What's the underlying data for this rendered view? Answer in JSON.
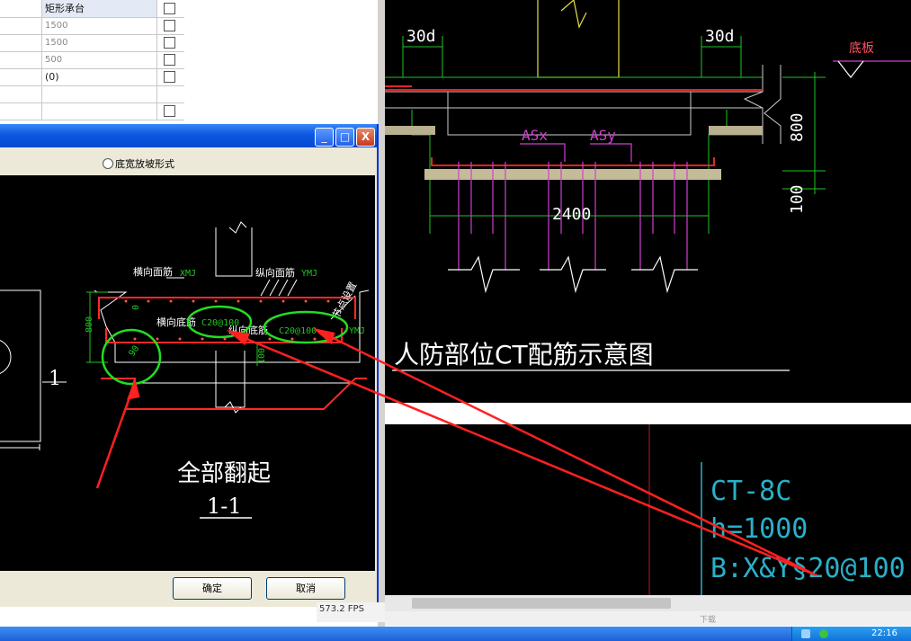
{
  "property_table": {
    "rows": [
      {
        "value": "矩形承台",
        "checked": false,
        "header": true
      },
      {
        "value": "1500",
        "checked": false
      },
      {
        "value": "1500",
        "checked": false
      },
      {
        "value": "500",
        "checked": false
      },
      {
        "value": "(0)",
        "checked": false
      },
      {
        "value": "",
        "checked": false
      },
      {
        "value": "",
        "checked": false
      }
    ]
  },
  "dialog": {
    "option_label": "底宽放坡形式",
    "ok_label": "确定",
    "cancel_label": "取消",
    "min_glyph": "_",
    "max_glyph": "□",
    "close_glyph": "X"
  },
  "drawing_left": {
    "section_mark": "1",
    "label_top_transverse": "横向面筋",
    "label_top_transverse_code": "XMJ",
    "label_top_longitudinal": "纵向面筋",
    "label_top_longitudinal_code": "YMJ",
    "label_node": "节点设置",
    "label_bottom_transverse": "横向底筋",
    "label_bottom_transverse_spec": "C20@100",
    "label_bottom_longitudinal": "纵向底筋",
    "label_bottom_longitudinal_spec": "C20@100",
    "label_bottom_longitudinal_code": "YMJ",
    "dim_800": "800",
    "dim_0": "0",
    "dim_90": "90",
    "dim_100": "100",
    "annotation": "全部翻起",
    "section_title": "1-1"
  },
  "drawing_right": {
    "dim_30d_left": "30d",
    "dim_30d_right": "30d",
    "label_floor": "底板",
    "label_asx": "ASx",
    "label_asy": "ASy",
    "dim_2400": "2400",
    "dim_800": "800",
    "dim_100": "100",
    "title": "人防部位CT配筋示意图",
    "tag_name": "CT-8C",
    "tag_height": "h=1000",
    "tag_rebar": "B:X&Y§20@100"
  },
  "fps_text": "573.2 FPS",
  "status_text": "下载",
  "clock": "22:16",
  "colors": {
    "cad_bg": "#000000",
    "rebar_red": "#ff2a2a",
    "dim_green": "#22c322",
    "leader_magenta": "#d040d0",
    "text_cyan": "#2ab0c8",
    "circle_green": "#22dd22",
    "xp_title_blue": "#0a58e0"
  }
}
